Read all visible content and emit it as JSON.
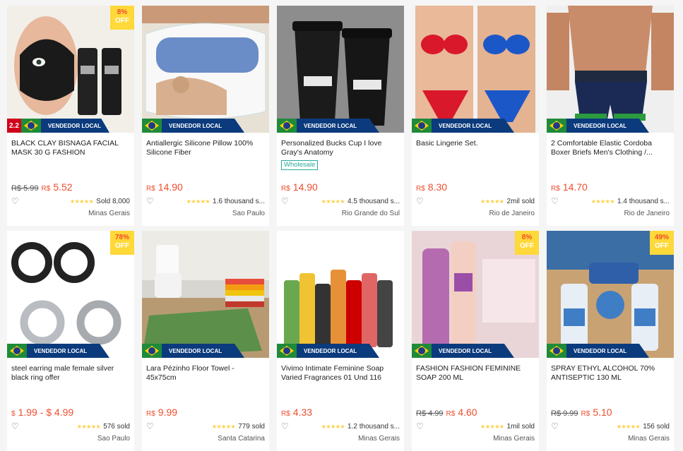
{
  "colors": {
    "accent_price": "#ee4d2d",
    "badge_yellow": "#ffd839",
    "seller_blue": "#0b3b7d",
    "star": "#ffce3d"
  },
  "products": [
    {
      "title": "BLACK CLAY BISNAGA FACIAL MASK 30 G FASHION",
      "discount": "8%",
      "discount_off": "OFF",
      "promo": "2.2",
      "seller": "VENDEDOR LOCAL",
      "old_price": "R$ 5.99",
      "currency": "R$",
      "price": "5.52",
      "stars": "★★★★★",
      "sold": "Sold 8,000",
      "location": "Minas Gerais",
      "icon": "mask-product-image"
    },
    {
      "title": "Antiallergic Silicone Pillow 100% Silicone Fiber",
      "seller": "VENDEDOR LOCAL",
      "currency": "R$",
      "price": "14.90",
      "stars": "★★★★★",
      "sold": "1.6 thousand s...",
      "location": "Sao Paulo",
      "icon": "pillow-product-image"
    },
    {
      "title": "Personalized Bucks Cup I love Gray's Anatomy",
      "badge": "Wholesale",
      "seller": "VENDEDOR LOCAL",
      "currency": "R$",
      "price": "14.90",
      "stars": "★★★★★",
      "sold": "4.5 thousand s...",
      "location": "Rio Grande do Sul",
      "icon": "cup-product-image"
    },
    {
      "title": "Basic Lingerie Set.",
      "seller": "VENDEDOR LOCAL",
      "currency": "R$",
      "price": "8.30",
      "stars": "★★★★★",
      "sold": "2mil sold",
      "location": "Rio de Janeiro",
      "icon": "lingerie-product-image"
    },
    {
      "title": "2 Comfortable Elastic Cordoba Boxer Briefs Men's Clothing /...",
      "seller": "VENDEDOR LOCAL",
      "currency": "R$",
      "price": "14.70",
      "stars": "★★★★★",
      "sold": "1.4 thousand s...",
      "location": "Rio de Janeiro",
      "icon": "boxer-product-image"
    },
    {
      "title": "steel earring male female silver black ring offer",
      "discount": "78%",
      "discount_off": "OFF",
      "seller": "VENDEDOR LOCAL",
      "currency": "$",
      "price": "1.99 - $ 4.99",
      "stars": "★★★★★",
      "sold": "576 sold",
      "location": "Sao Paulo",
      "icon": "earring-product-image"
    },
    {
      "title": "Lara Pézinho Floor Towel - 45x75cm",
      "seller": "VENDEDOR LOCAL",
      "currency": "R$",
      "price": "9.99",
      "stars": "★★★★★",
      "sold": "779 sold",
      "location": "Santa Catarina",
      "icon": "towel-product-image"
    },
    {
      "title": "Vivimo Intimate Feminine Soap Varied Fragrances 01 Und 116",
      "seller": "VENDEDOR LOCAL",
      "currency": "R$",
      "price": "4.33",
      "stars": "★★★★★",
      "sold": "1.2 thousand s...",
      "location": "Minas Gerais",
      "icon": "soap-product-image"
    },
    {
      "title": "FASHION FASHION FEMININE SOAP 200 ML",
      "discount": "8%",
      "discount_off": "OFF",
      "seller": "VENDEDOR LOCAL",
      "old_price": "R$ 4.99",
      "currency": "R$",
      "price": "4.60",
      "stars": "★★★★★",
      "sold": "1mil sold",
      "location": "Minas Gerais",
      "icon": "feminine-soap-product-image"
    },
    {
      "title": "SPRAY ETHYL ALCOHOL 70% ANTISEPTIC 130 ML",
      "discount": "49%",
      "discount_off": "OFF",
      "seller": "VENDEDOR LOCAL",
      "old_price": "R$ 9.99",
      "currency": "R$",
      "price": "5.10",
      "stars": "★★★★★",
      "sold": "156 sold",
      "location": "Minas Gerais",
      "icon": "alcohol-spray-product-image"
    }
  ]
}
